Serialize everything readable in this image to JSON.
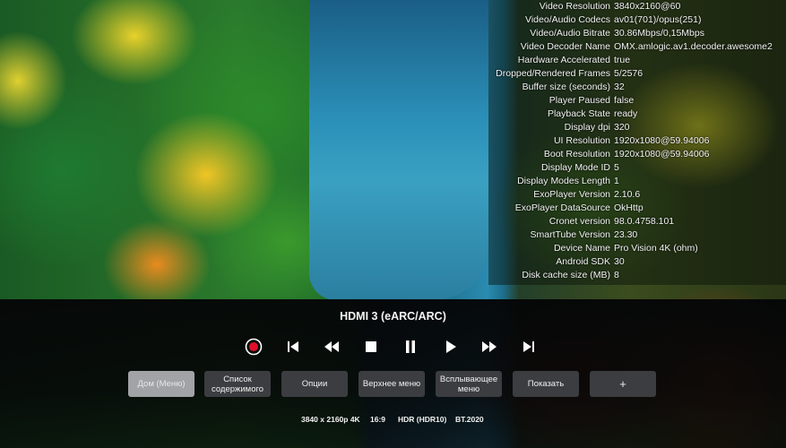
{
  "stats": [
    {
      "key": "Video Resolution",
      "value": "3840x2160@60"
    },
    {
      "key": "Video/Audio Codecs",
      "value": "av01(701)/opus(251)"
    },
    {
      "key": "Video/Audio Bitrate",
      "value": "30.86Mbps/0,15Mbps"
    },
    {
      "key": "Video Decoder Name",
      "value": "OMX.amlogic.av1.decoder.awesome2"
    },
    {
      "key": "Hardware Accelerated",
      "value": "true"
    },
    {
      "key": "Dropped/Rendered Frames",
      "value": "5/2576"
    },
    {
      "key": "Buffer size (seconds)",
      "value": "32"
    },
    {
      "key": "Player Paused",
      "value": "false"
    },
    {
      "key": "Playback State",
      "value": "ready"
    },
    {
      "key": "Display dpi",
      "value": "320"
    },
    {
      "key": "UI Resolution",
      "value": "1920x1080@59.94006"
    },
    {
      "key": "Boot Resolution",
      "value": "1920x1080@59.94006"
    },
    {
      "key": "Display Mode ID",
      "value": "5"
    },
    {
      "key": "Display Modes Length",
      "value": "1"
    },
    {
      "key": "ExoPlayer Version",
      "value": "2.10.6"
    },
    {
      "key": "ExoPlayer DataSource",
      "value": "OkHttp"
    },
    {
      "key": "Cronet version",
      "value": "98.0.4758.101"
    },
    {
      "key": "SmartTube Version",
      "value": "23.30"
    },
    {
      "key": "Device Name",
      "value": "Pro Vision 4K (ohm)"
    },
    {
      "key": "Android SDK",
      "value": "30"
    },
    {
      "key": "Disk cache size (MB)",
      "value": "8"
    }
  ],
  "source_title": "HDMI 3 (eARC/ARC)",
  "transport": {
    "icons": [
      "record-icon",
      "skip-previous-icon",
      "rewind-icon",
      "stop-icon",
      "pause-icon",
      "play-icon",
      "fast-forward-icon",
      "skip-next-icon"
    ],
    "record_color": "#e0102a"
  },
  "menu": {
    "home": "Дом (Меню)",
    "content_list_1": "Список",
    "content_list_2": "содержимого",
    "options": "Опции",
    "top_menu": "Верхнее меню",
    "popup_menu_1": "Всплывающее",
    "popup_menu_2": "меню",
    "show": "Показать",
    "plus": "+"
  },
  "info": {
    "resolution": "3840 x 2160p 4K",
    "aspect": "16:9",
    "hdr": "HDR (HDR10)",
    "colorspace": "BT.2020"
  }
}
